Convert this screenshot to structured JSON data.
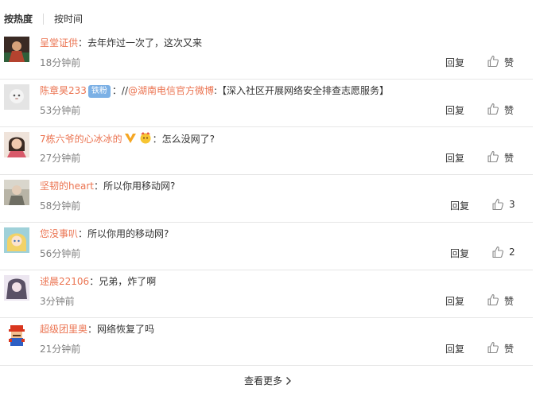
{
  "sort": {
    "hot": "按热度",
    "time": "按时间"
  },
  "comments": [
    {
      "user": "呈堂证供",
      "text": "：去年炸过一次了，这次又来",
      "time": "18分钟前",
      "reply": "回复",
      "like": "赞",
      "avatar_color": "#a25b3a"
    },
    {
      "user": "陈章昊233",
      "badge": "铁粉",
      "text_prefix": "：//",
      "mention": "@湖南电信官方微博",
      "text": ":【深入社区开展网络安全排查志愿服务】",
      "time": "53分钟前",
      "reply": "回复",
      "like": "赞",
      "avatar_color": "#d8d8d8"
    },
    {
      "user": "7栋六爷的心冰冰的",
      "text": "：怎么没网了?",
      "time": "27分钟前",
      "reply": "回复",
      "like": "赞",
      "avatar_color": "#caa58a"
    },
    {
      "user": "坚韧的heart",
      "text": "：所以你用移动网?",
      "time": "58分钟前",
      "reply": "回复",
      "like": "3",
      "avatar_color": "#8a8a7a"
    },
    {
      "user": "您没事叭",
      "text": "：所以你用的移动网?",
      "time": "56分钟前",
      "reply": "回复",
      "like": "2",
      "avatar_color": "#e6cc66"
    },
    {
      "user": "逑晨22106",
      "text": "：兄弟，炸了啊",
      "time": "3分钟前",
      "reply": "回复",
      "like": "赞",
      "avatar_color": "#c9b9d4"
    },
    {
      "user": "超级团里奥",
      "text": "：网络恢复了吗",
      "time": "21分钟前",
      "reply": "回复",
      "like": "赞",
      "avatar_color": "#d9361e"
    }
  ],
  "more_label": "查看更多",
  "colors": {
    "link": "#eb7350",
    "badge": "#7bb0e5",
    "separator": "#e6e6e6"
  },
  "icons": {
    "like": "thumbs-up-icon",
    "more": "chevron-right-icon",
    "verified": "v-badge-icon"
  }
}
